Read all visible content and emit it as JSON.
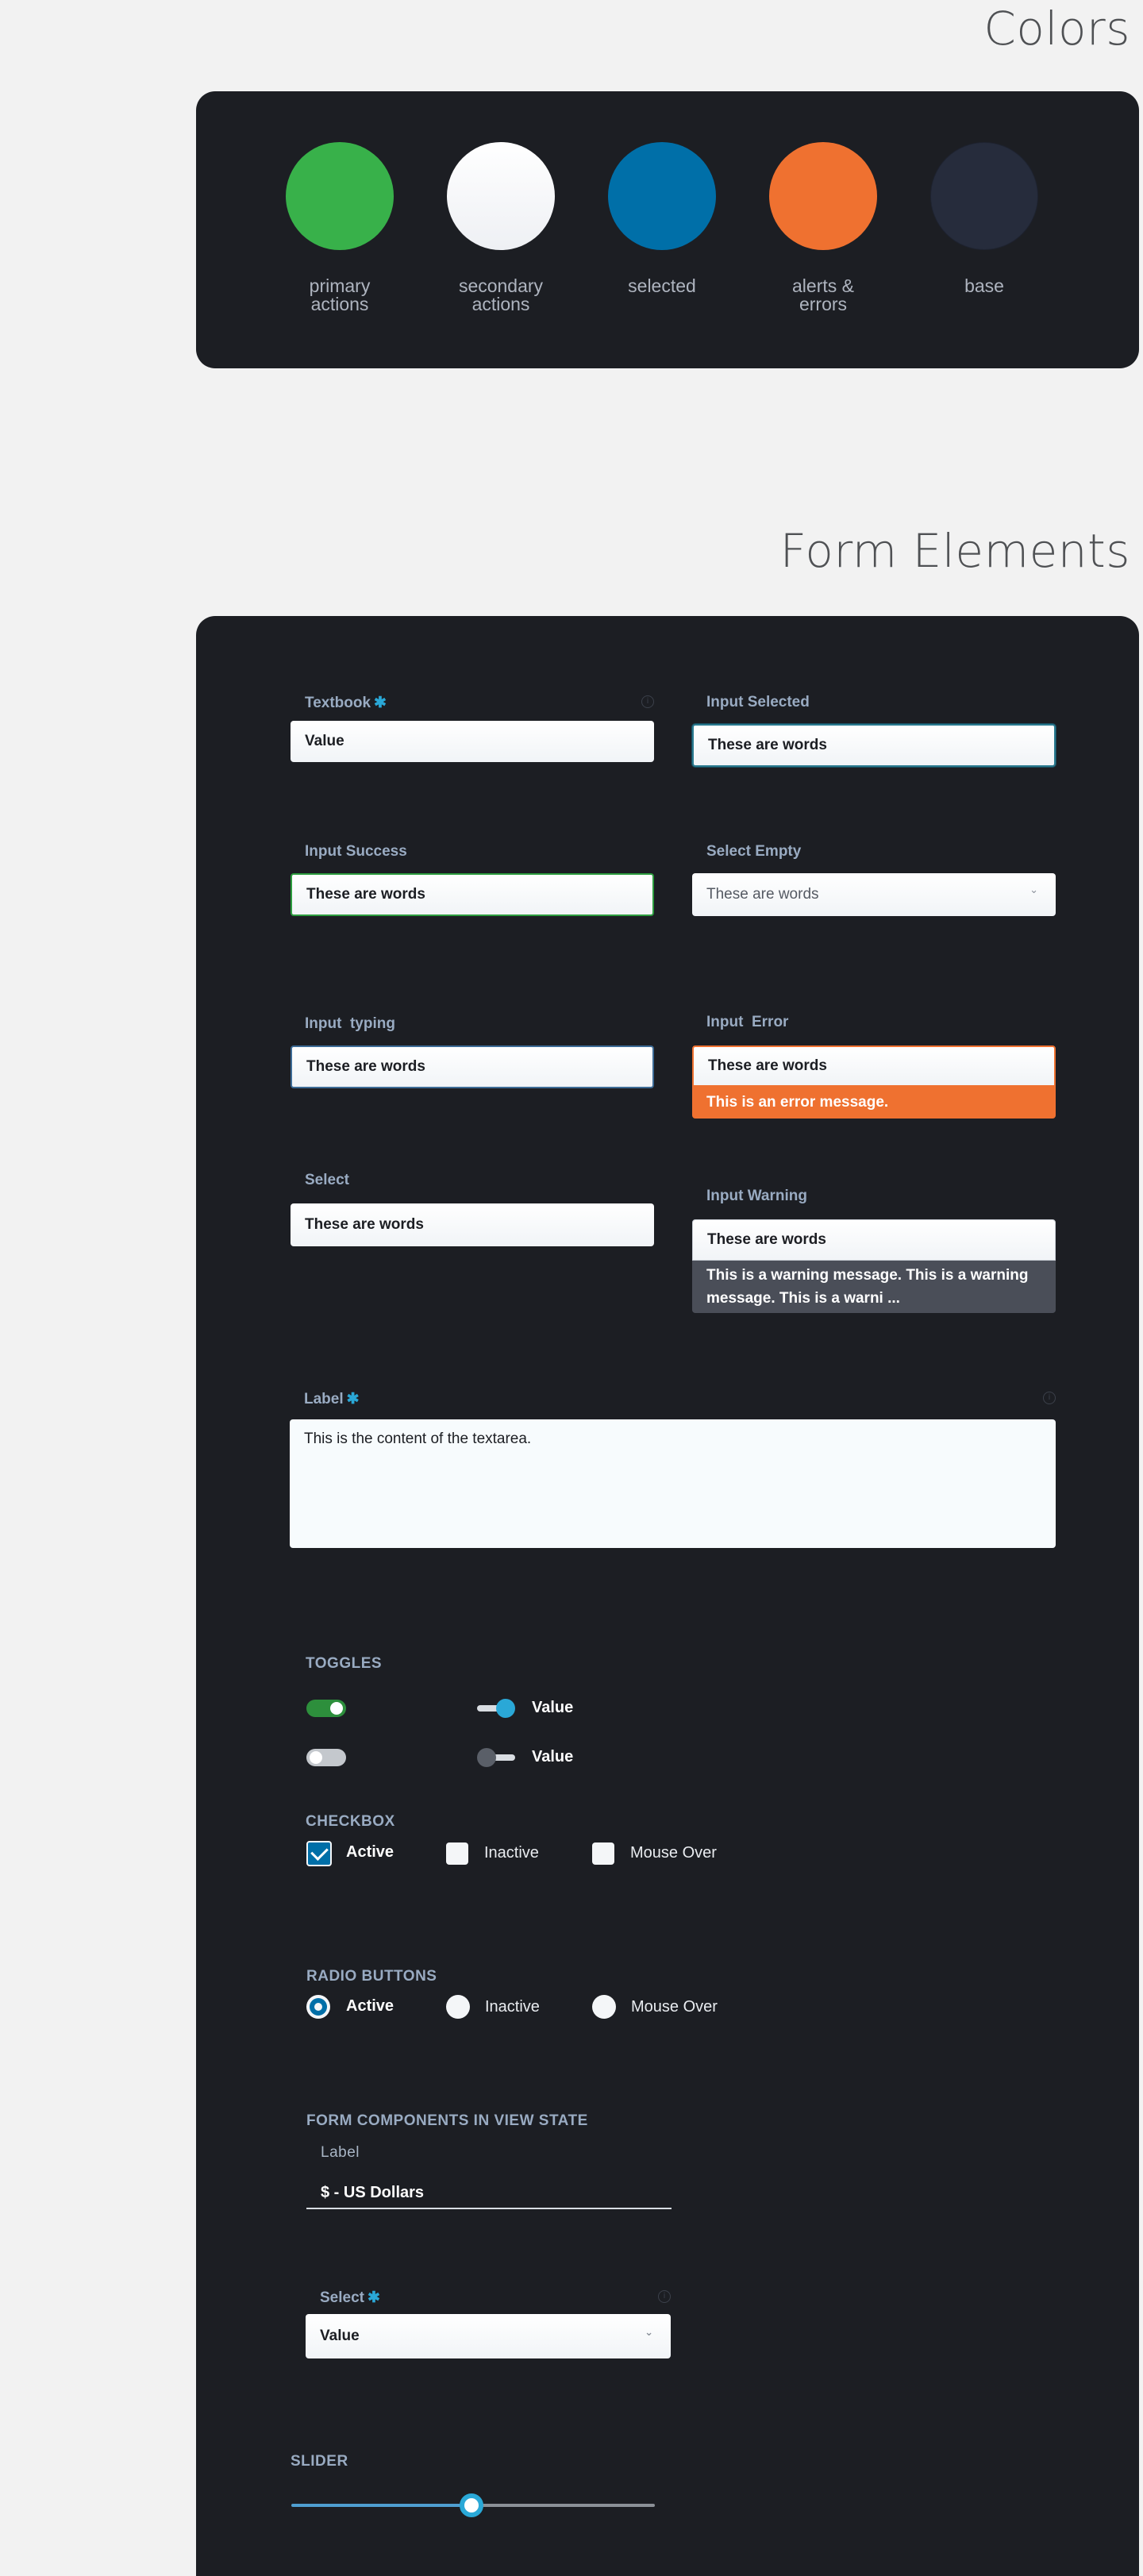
{
  "colors_section": {
    "title": "Colors",
    "swatches": [
      {
        "label": "primary\nactions",
        "color": "#38b14a"
      },
      {
        "label": "secondary\nactions",
        "color": "#f7f8fa"
      },
      {
        "label": "selected",
        "color": "#006fa8"
      },
      {
        "label": "alerts &\nerrors",
        "color": "#ef7130"
      },
      {
        "label": "base",
        "color": "#262c3c"
      }
    ]
  },
  "form_section": {
    "title": "Form Elements",
    "textbook": {
      "label": "Textbook",
      "required": "✱",
      "value": "Value"
    },
    "input_selected": {
      "label": "Input Selected",
      "value": "These are words"
    },
    "input_success": {
      "label": "Input Success",
      "value": "These are words"
    },
    "select_empty": {
      "label": "Select Empty",
      "value": "These are words"
    },
    "input_typing": {
      "label": "Input  typing",
      "value": "These are words"
    },
    "input_error": {
      "label": "Input  Error",
      "value": "These are words",
      "message": "This is an error message."
    },
    "select": {
      "label": "Select",
      "value": "These are words"
    },
    "input_warning": {
      "label": "Input Warning",
      "value": "These are words",
      "message": "This is a warning message. This is a warning message. This is a warni ..."
    },
    "textarea": {
      "label": "Label",
      "required": "✱",
      "value": "This is the content of the textarea."
    },
    "toggles": {
      "heading": "TOGGLES",
      "items": [
        {
          "label": "",
          "state": "on"
        },
        {
          "label": "Value",
          "state": "on"
        },
        {
          "label": "",
          "state": "off"
        },
        {
          "label": "Value",
          "state": "off"
        }
      ]
    },
    "checkbox": {
      "heading": "CHECKBOX",
      "items": [
        {
          "label": "Active",
          "checked": true
        },
        {
          "label": "Inactive",
          "checked": false
        },
        {
          "label": "Mouse Over",
          "checked": false
        }
      ]
    },
    "radio": {
      "heading": "RADIO BUTTONS",
      "items": [
        {
          "label": "Active",
          "selected": true
        },
        {
          "label": "Inactive",
          "selected": false
        },
        {
          "label": "Mouse Over",
          "selected": false
        }
      ]
    },
    "view_state": {
      "heading": "FORM COMPONENTS IN VIEW STATE",
      "label": "Label",
      "value": "$ - US Dollars"
    },
    "select_required": {
      "label": "Select",
      "required": "✱",
      "value": "Value"
    },
    "slider": {
      "heading": "SLIDER",
      "value_fraction": 0.495
    }
  }
}
